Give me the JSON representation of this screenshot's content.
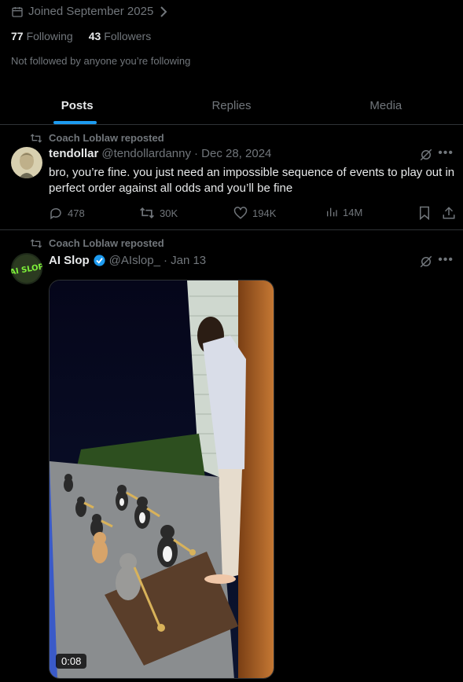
{
  "profile": {
    "joined": "Joined September 2025",
    "following_count": "77",
    "following_label": "Following",
    "followers_count": "43",
    "followers_label": "Followers",
    "not_followed": "Not followed by anyone you’re following"
  },
  "tabs": [
    {
      "label": "Posts",
      "active": true
    },
    {
      "label": "Replies",
      "active": false
    },
    {
      "label": "Media",
      "active": false
    }
  ],
  "posts": [
    {
      "repost_label": "Coach Loblaw reposted",
      "name": "tendollar",
      "handle": "@tendollardanny",
      "date": "· Dec 28, 2024",
      "text": "bro, you’re fine. you just need an impossible sequence of events to play out in perfect order against all odds and you’ll be fine",
      "replies": "478",
      "reposts": "30K",
      "likes": "194K",
      "views": "14M"
    },
    {
      "repost_label": "Coach Loblaw reposted",
      "name": "AI Slop",
      "handle": "@AIslop_",
      "date": "· Jan 13",
      "avatar_text": "AI SLOP",
      "video_duration": "0:08"
    }
  ],
  "colors": {
    "accent": "#1d9bf0",
    "muted": "#71767b",
    "text": "#e7e9ea",
    "border": "#2f3336",
    "background": "#000000"
  }
}
